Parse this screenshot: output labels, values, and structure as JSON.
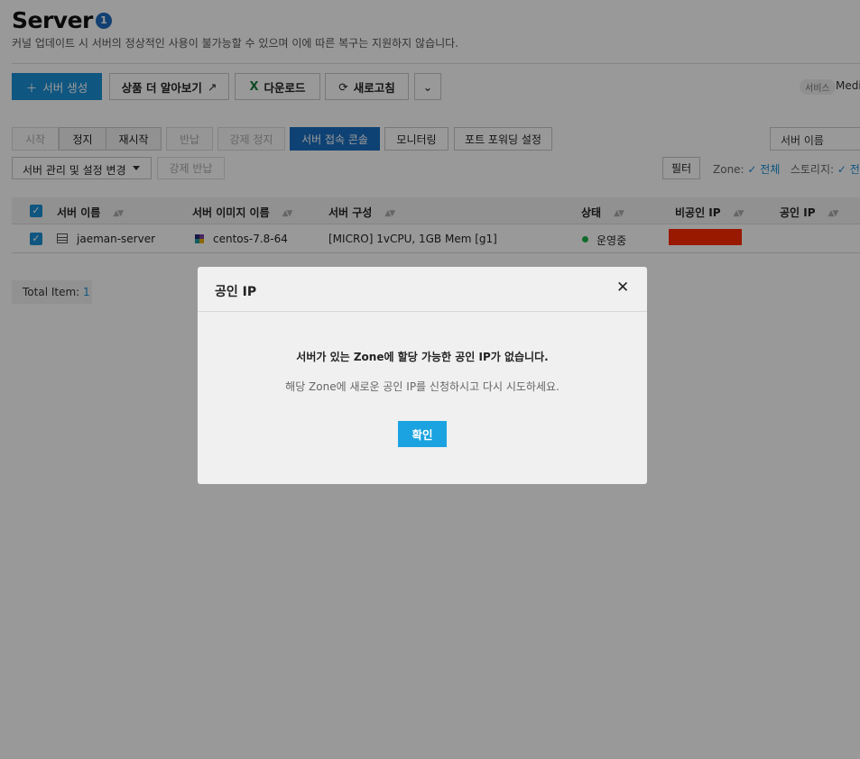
{
  "page": {
    "title": "Server",
    "badge": "1",
    "subtitle": "커널 업데이트 시 서버의 정상적인 사용이 불가능할 수 있으며 이에 따른 복구는 지원하지 않습니다."
  },
  "toolbar": {
    "create_label": "서버 생성",
    "learn_more_label": "상품 더 알아보기",
    "download_label": "다운로드",
    "refresh_label": "새로고침",
    "service_tag": "서비스",
    "service_value": "Medi"
  },
  "actions": {
    "start": "시작",
    "stop": "정지",
    "restart": "재시작",
    "return": "반납",
    "force_stop": "강제 정지",
    "console": "서버 접속 콘솔",
    "monitoring": "모니터링",
    "port_forwarding": "포트 포워딩 설정",
    "manage": "서버 관리 및 설정 변경",
    "force_return": "강제 반납"
  },
  "search": {
    "placeholder": "서버 이름"
  },
  "filter": {
    "button": "필터",
    "zone_label": "Zone:",
    "zone_value": "전체",
    "storage_label": "스토리지:",
    "storage_value": "전체"
  },
  "table": {
    "columns": [
      "서버 이름",
      "서버 이미지 이름",
      "서버 구성",
      "상태",
      "비공인 IP",
      "공인 IP"
    ],
    "rows": [
      {
        "name": "jaeman-server",
        "image": "centos-7.8-64",
        "spec": "[MICRO] 1vCPU, 1GB Mem [g1]",
        "status": "운영중",
        "private_ip": "",
        "public_ip": ""
      }
    ]
  },
  "footer": {
    "total_label": "Total Item:",
    "total_count": "1"
  },
  "modal": {
    "title": "공인 IP",
    "message": "서버가 있는 Zone에 할당 가능한 공인 IP가 없습니다.",
    "sub_message": "해당 Zone에 새로운 공인 IP를 신청하시고 다시 시도하세요.",
    "confirm_label": "확인"
  },
  "colors": {
    "primary": "#1a8fd6",
    "console_button": "#1a6fc2",
    "status_running": "#1cb348",
    "redaction": "#ff2a00",
    "modal_confirm": "#1aa3e0"
  }
}
